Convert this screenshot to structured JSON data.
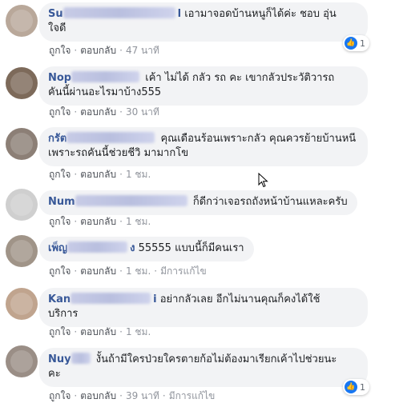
{
  "colors": {
    "author": "#385898",
    "bubble": "#f2f3f5",
    "like": "#1877f2",
    "meta": "#90949c"
  },
  "comments": [
    {
      "author_visible": "Su",
      "author_tail": "l",
      "text_line1": "เอามาจอดบ้านหนูก็ได้ค่ะ ชอบ อุ่น",
      "text_line2": "ใจดี",
      "like": "ถูกใจ",
      "reply": "ตอบกลับ",
      "time": "47 นาที",
      "reactions": "1"
    },
    {
      "author_visible": "Nop",
      "author_tail": "",
      "text_line1": "เค้า ไม่ได้ กลัว รถ คะ เขากลัวประวัติวารถ",
      "text_line2": "คันนี้ผ่านอะไรมาบ้าง555",
      "like": "ถูกใจ",
      "reply": "ตอบกลับ",
      "time": "30 นาที"
    },
    {
      "author_visible": "กรัต",
      "author_tail": "",
      "text_line1": "คุณเดือนร้อนเพราะกลัว คุณควรย้ายบ้านหนี",
      "text_line2": "เพราะรถคันนี้ช่วยชีวิ มามากโข",
      "like": "ถูกใจ",
      "reply": "ตอบกลับ",
      "time": "1 ชม."
    },
    {
      "author_visible": "Num",
      "author_tail": "",
      "text_line1": "ก็ดีกว่าเจอรถถังหน้าบ้านแหละครับ",
      "like": "ถูกใจ",
      "reply": "ตอบกลับ",
      "time": "1 ชม."
    },
    {
      "author_visible": "เพ็ญ",
      "author_tail": "ง",
      "text_line1": "55555 แบบนี้ก็มีคนเรา",
      "like": "ถูกใจ",
      "reply": "ตอบกลับ",
      "time": "1 ชม.",
      "edited": "มีการแก้ไข"
    },
    {
      "author_visible": "Kan",
      "author_tail": "i",
      "text_line1": "อย่ากลัวเลย อีกไม่นานคุณก็คงได้ใช้",
      "text_line2": "บริการ",
      "like": "ถูกใจ",
      "reply": "ตอบกลับ",
      "time": "1 ชม."
    },
    {
      "author_visible": "Nuy",
      "author_tail": "",
      "text_line1": "งั้นถ้ามีใครป่วยใครตายก้อไม่ต้องมาเรียกเค้าไปช่วยนะ",
      "text_line2": "คะ",
      "like": "ถูกใจ",
      "reply": "ตอบกลับ",
      "time": "39 นาที",
      "edited": "มีการแก้ไข",
      "reactions": "1"
    }
  ]
}
